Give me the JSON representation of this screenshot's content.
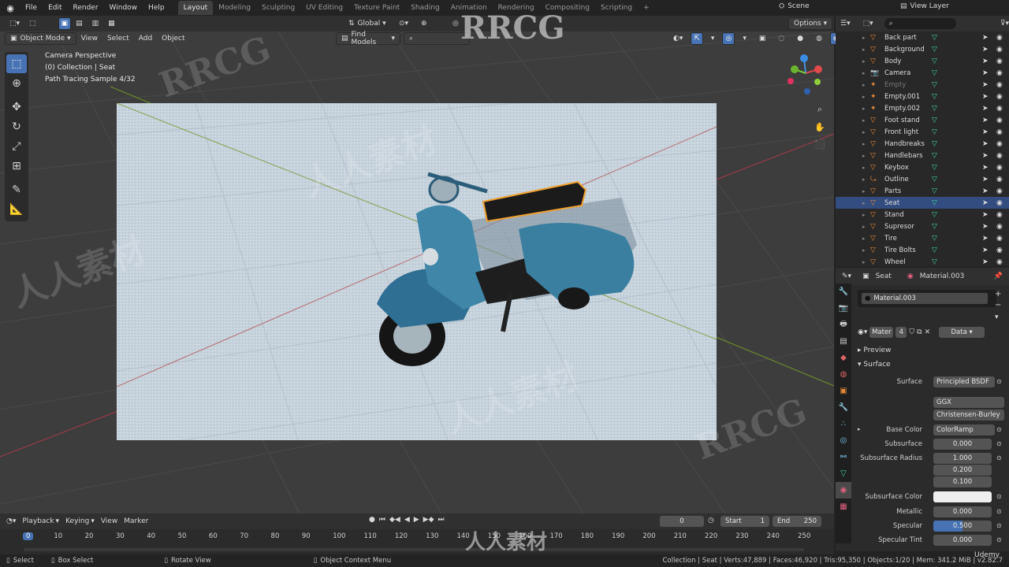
{
  "menus": [
    "File",
    "Edit",
    "Render",
    "Window",
    "Help"
  ],
  "workspaces": [
    "Layout",
    "Modeling",
    "Sculpting",
    "UV Editing",
    "Texture Paint",
    "Shading",
    "Animation",
    "Rendering",
    "Compositing",
    "Scripting"
  ],
  "active_workspace": "Layout",
  "scene_name": "Scene",
  "view_layer": "View Layer",
  "header2": {
    "orientation": "Global",
    "options": "Options"
  },
  "header3": {
    "mode": "Object Mode",
    "view": "View",
    "select": "Select",
    "add": "Add",
    "object": "Object",
    "find_models": "Find Models"
  },
  "viewport": {
    "info_line1": "Camera Perspective",
    "info_line2": "(0) Collection | Seat",
    "info_line3": "Path Tracing Sample 4/32"
  },
  "outliner": {
    "search_placeholder": "",
    "items": [
      {
        "name": "Back part",
        "faded": false,
        "selected": false
      },
      {
        "name": "Background",
        "faded": false,
        "selected": false
      },
      {
        "name": "Body",
        "faded": false,
        "selected": false
      },
      {
        "name": "Camera",
        "faded": false,
        "selected": false
      },
      {
        "name": "Empty",
        "faded": true,
        "selected": false
      },
      {
        "name": "Empty.001",
        "faded": false,
        "selected": false
      },
      {
        "name": "Empty.002",
        "faded": false,
        "selected": false
      },
      {
        "name": "Foot stand",
        "faded": false,
        "selected": false
      },
      {
        "name": "Front light",
        "faded": false,
        "selected": false
      },
      {
        "name": "Handbreaks",
        "faded": false,
        "selected": false
      },
      {
        "name": "Handlebars",
        "faded": false,
        "selected": false
      },
      {
        "name": "Keybox",
        "faded": false,
        "selected": false
      },
      {
        "name": "Outline",
        "faded": false,
        "selected": false
      },
      {
        "name": "Parts",
        "faded": false,
        "selected": false
      },
      {
        "name": "Seat",
        "faded": false,
        "selected": true
      },
      {
        "name": "Stand",
        "faded": false,
        "selected": false
      },
      {
        "name": "Supresor",
        "faded": false,
        "selected": false
      },
      {
        "name": "Tire",
        "faded": false,
        "selected": false
      },
      {
        "name": "Tire Bolts",
        "faded": false,
        "selected": false
      },
      {
        "name": "Wheel",
        "faded": false,
        "selected": false
      }
    ]
  },
  "properties": {
    "object": "Seat",
    "material": "Material.003",
    "slot": "Material.003",
    "mat_name": "Mater",
    "mat_users": "4",
    "data_link": "Data",
    "preview": "Preview",
    "surface_section": "Surface",
    "rows": {
      "surface_label": "Surface",
      "surface_value": "Principled BSDF",
      "distribution": "GGX",
      "subsurface_method": "Christensen-Burley",
      "base_color_label": "Base Color",
      "base_color_value": "ColorRamp",
      "subsurface_label": "Subsurface",
      "subsurface_value": "0.000",
      "ss_radius_label": "Subsurface Radius",
      "ss_radius_1": "1.000",
      "ss_radius_2": "0.200",
      "ss_radius_3": "0.100",
      "ss_color_label": "Subsurface Color",
      "metallic_label": "Metallic",
      "metallic_value": "0.000",
      "specular_label": "Specular",
      "specular_value": "0.500",
      "specular_tint_label": "Specular Tint",
      "specular_tint_value": "0.000"
    }
  },
  "timeline": {
    "playback": "Playback",
    "keying": "Keying",
    "view": "View",
    "marker": "Marker",
    "current_frame": "0",
    "start_label": "Start",
    "start": "1",
    "end_label": "End",
    "end": "250",
    "ticks": [
      "0",
      "10",
      "20",
      "30",
      "40",
      "50",
      "60",
      "70",
      "80",
      "90",
      "100",
      "110",
      "120",
      "130",
      "140",
      "150",
      "160",
      "170",
      "180",
      "190",
      "200",
      "210",
      "220",
      "230",
      "240",
      "250"
    ]
  },
  "statusbar": {
    "select": "Select",
    "box_select": "Box Select",
    "rotate_view": "Rotate View",
    "context_menu": "Object Context Menu",
    "stats": "Collection | Seat | Verts:47,889 | Faces:46,920 | Tris:95,350 | Objects:1/20 | Mem: 341.2 MiB | v2.82.7"
  },
  "watermarks": {
    "rrcg": "RRCG",
    "cn": "人人素材",
    "udemy": "Udemy"
  },
  "colors": {
    "accent": "#4772b3",
    "selection": "#334d80",
    "scooter": "#3f86a8",
    "seat_outline": "#f0a030"
  }
}
